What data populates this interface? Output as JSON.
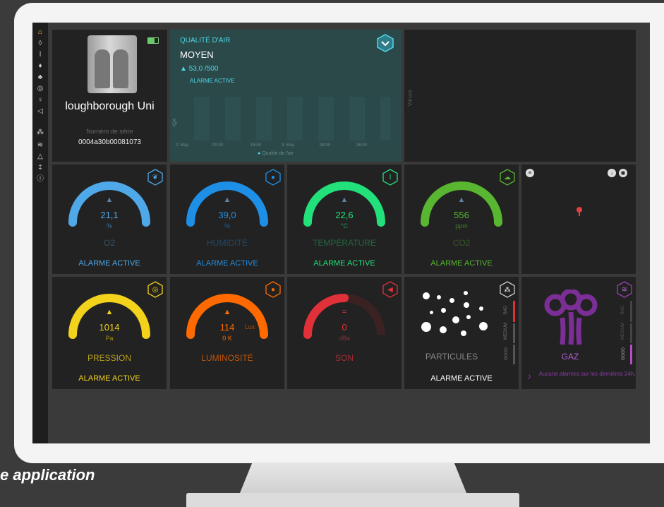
{
  "caption": "e application",
  "device": {
    "name": "loughborough Uni",
    "serial_label": "Numéro de série",
    "serial": "0004a30b00081073"
  },
  "air_quality": {
    "title": "QUALITÉ D'AIR",
    "level": "MOYEN",
    "value": "53,0 /500",
    "alarm": "ALARME ACTIVE",
    "y_axis": "IQA",
    "x_ticks": [
      "2. May",
      "00:00",
      "16:00",
      "3. May",
      "08:00",
      "16:00"
    ],
    "legend": "Qualité de l'air"
  },
  "values_panel": {
    "axis_label": "Values"
  },
  "gauges": [
    {
      "value": "21,1",
      "unit": "%",
      "name": "O2",
      "alarm": "ALARME ACTIVE",
      "color": "#4fa8e8",
      "fraction": 1.0,
      "arrow": "up",
      "icon": "leaves-icon"
    },
    {
      "value": "39,0",
      "unit": "%",
      "name": "HUMIDITÉ",
      "alarm": "ALARME ACTIVE",
      "color": "#1e8fe6",
      "fraction": 1.0,
      "arrow": "up",
      "icon": "water-drop-icon"
    },
    {
      "value": "22,6",
      "unit": "°C",
      "name": "TEMPÉRATURE",
      "alarm": "ALARME ACTIVE",
      "color": "#22e07a",
      "fraction": 1.0,
      "arrow": "up",
      "icon": "thermometer-icon"
    },
    {
      "value": "556",
      "unit": "ppm",
      "name": "CO2",
      "alarm": "ALARME ACTIVE",
      "color": "#58b630",
      "fraction": 1.0,
      "arrow": "up",
      "icon": "cloud-icon"
    },
    {
      "value": "1014",
      "unit": "Pa",
      "name": "PRESSION",
      "alarm": "ALARME ACTIVE",
      "color": "#f2d21a",
      "fraction": 1.0,
      "arrow": "up",
      "icon": "gauge-icon"
    },
    {
      "value": "114",
      "unit": "Lux",
      "name": "LUMINOSITÉ",
      "alarm": "",
      "color": "#ff6a00",
      "fraction": 1.0,
      "arrow": "up",
      "icon": "bulb-icon",
      "extra": "0",
      "extra_unit": "K"
    },
    {
      "value": "0",
      "unit": "dBa",
      "name": "SON",
      "alarm": "",
      "color": "#e0303a",
      "fraction": 0.5,
      "arrow": "equal",
      "icon": "speaker-icon"
    }
  ],
  "particles": {
    "name": "PARTICULES",
    "alarm": "ALARME ACTIVE",
    "scale": [
      "BAD",
      "MEDIUM",
      "GOOD"
    ]
  },
  "gas": {
    "name": "GAZ",
    "notice": "Aucune alarmes sur les dernières 24h.",
    "scale": [
      "BAD",
      "MEDIUM",
      "GOOD"
    ]
  },
  "sidebar_icons": [
    "home-icon",
    "drop-icon",
    "thermometer-icon",
    "flame-icon",
    "plant-icon",
    "gauge-icon",
    "bulb-icon",
    "speaker-icon",
    "particles-icon",
    "gas-icon",
    "bell-icon",
    "settings-icon",
    "info-icon"
  ],
  "colors": {
    "tile": "#222222",
    "accent_teal": "#3fd3e6",
    "air_tile": "#2c4a4a"
  }
}
